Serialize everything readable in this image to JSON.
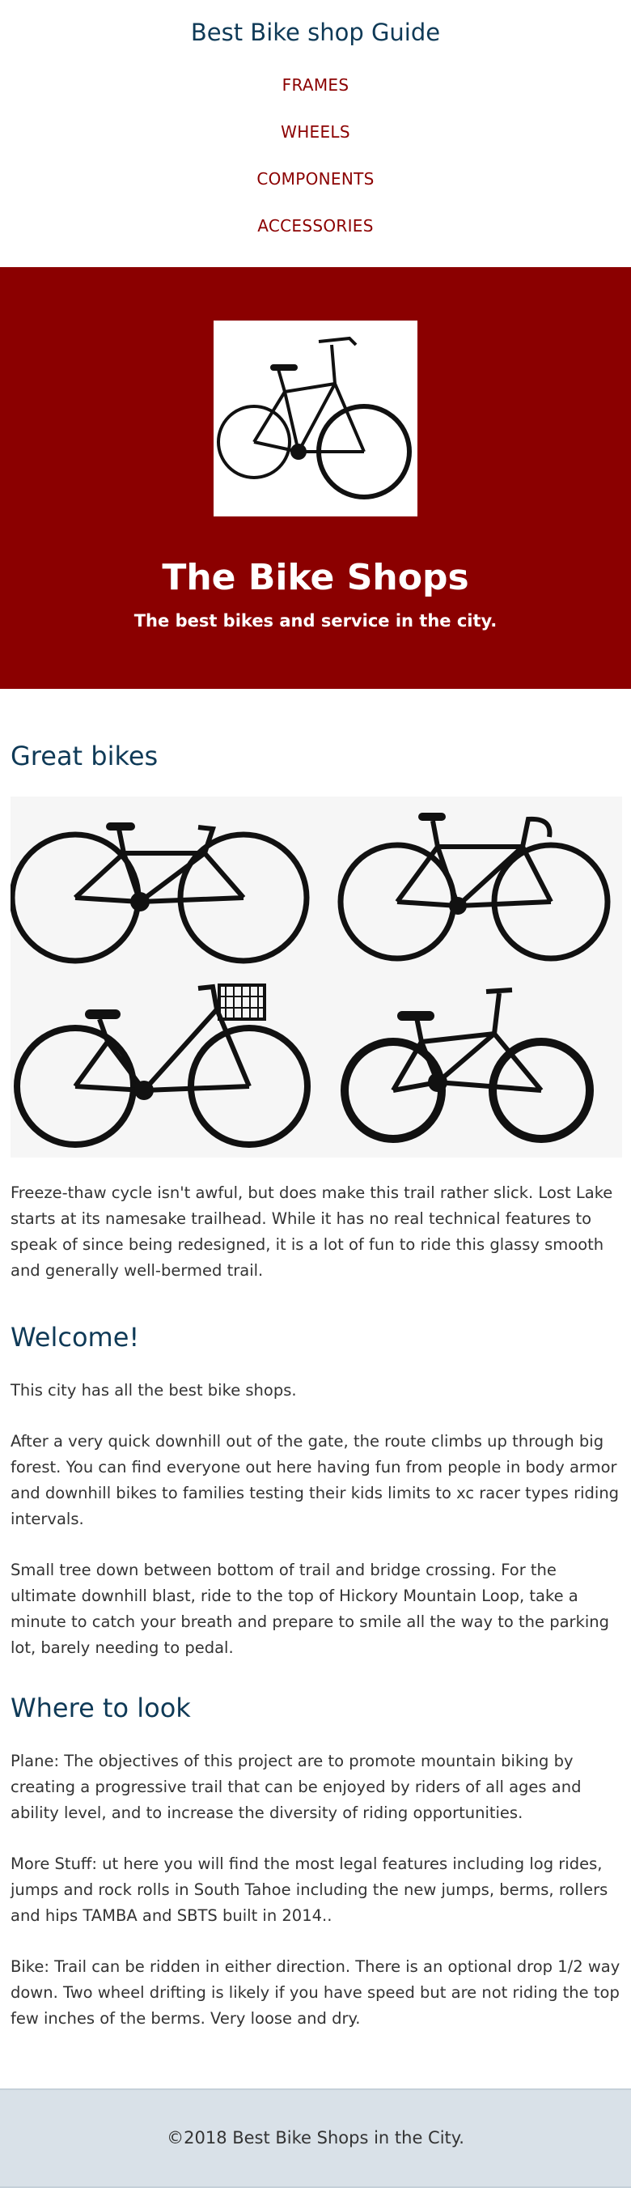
{
  "header": {
    "title": "Best Bike shop Guide",
    "nav": [
      {
        "label": "FRAMES"
      },
      {
        "label": "WHEELS"
      },
      {
        "label": "COMPONENTS"
      },
      {
        "label": "ACCESSORIES"
      }
    ]
  },
  "hero": {
    "title": "The Bike Shops",
    "tagline": "The best bikes and service in the city."
  },
  "great_bikes": {
    "title": "Great bikes",
    "text": "Freeze-thaw cycle isn't awful, but does make this trail rather slick. Lost Lake starts at its namesake trailhead. While it has no real technical features to speak of since being redesigned, it is a lot of fun to ride this glassy smooth and generally well-bermed trail."
  },
  "welcome": {
    "title": "Welcome!",
    "paragraphs": [
      "This city has all the best bike shops.",
      "After a very quick downhill out of the gate, the route climbs up through big forest. You can find everyone out here having fun from people in body armor and downhill bikes to families testing their kids limits to xc racer types riding intervals.",
      "Small tree down between bottom of trail and bridge crossing. For the ultimate downhill blast, ride to the top of Hickory Mountain Loop, take a minute to catch your breath and prepare to smile all the way to the parking lot, barely needing to pedal."
    ]
  },
  "where": {
    "title": "Where to look",
    "paragraphs": [
      "Plane: The objectives of this project are to promote mountain biking by creating a progressive trail that can be enjoyed by riders of all ages and ability level, and to increase the diversity of riding opportunities.",
      "More Stuff: ut here you will find the most legal features including log rides, jumps and rock rolls in South Tahoe including the new jumps, berms, rollers and hips TAMBA and SBTS built in 2014..",
      "Bike: Trail can be ridden in either direction. There is an optional drop 1/2 way down. Two wheel drifting is likely if you have speed but are not riding the top few inches of the berms. Very loose and dry."
    ]
  },
  "footer": {
    "text": "©2018 Best Bike Shops in the City."
  },
  "colors": {
    "brand_red": "#8b0000",
    "heading_blue": "#0f3a57",
    "footer_bg": "#d9e1e8"
  }
}
